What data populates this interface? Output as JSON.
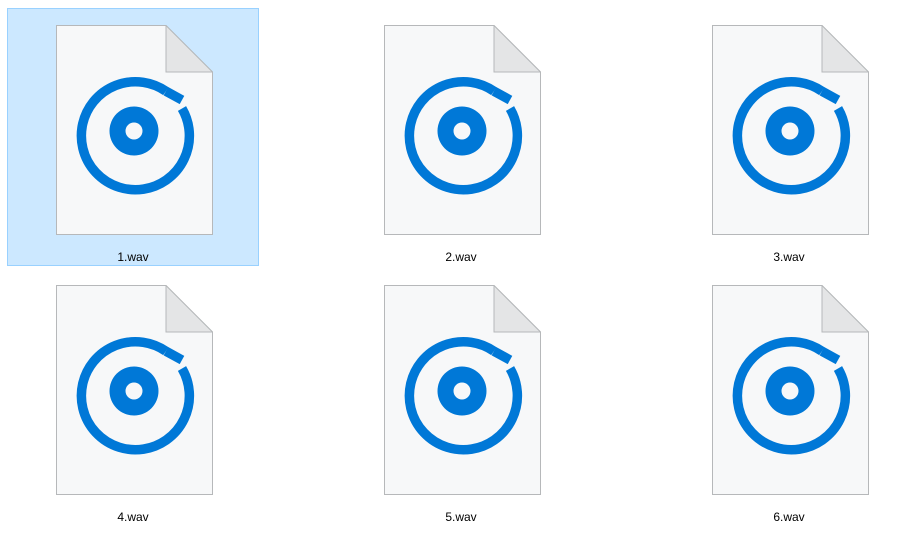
{
  "files": [
    {
      "name": "1.wav",
      "selected": true
    },
    {
      "name": "2.wav",
      "selected": false
    },
    {
      "name": "3.wav",
      "selected": false
    },
    {
      "name": "4.wav",
      "selected": false
    },
    {
      "name": "5.wav",
      "selected": false
    },
    {
      "name": "6.wav",
      "selected": false
    }
  ],
  "icon": {
    "name": "groove-music-file-icon",
    "accent_color": "#0078d7",
    "page_color": "#f7f8f9",
    "fold_color": "#e4e5e6",
    "border_color": "#b6b8ba"
  },
  "selection": {
    "background": "#cce8ff",
    "border": "#99d1ff"
  }
}
